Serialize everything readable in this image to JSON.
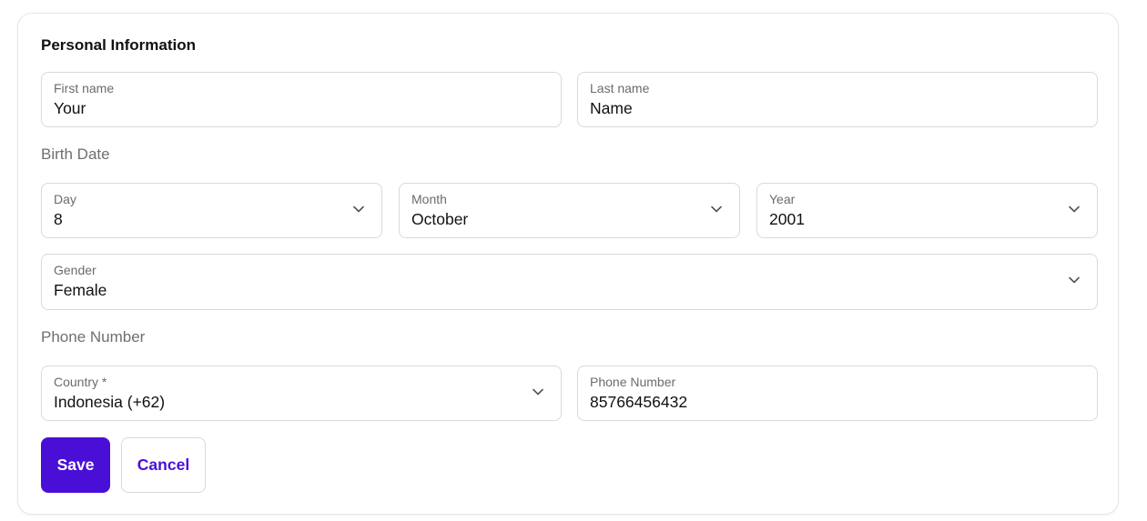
{
  "form": {
    "title": "Personal Information",
    "first_name": {
      "label": "First name",
      "value": "Your"
    },
    "last_name": {
      "label": "Last name",
      "value": "Name"
    },
    "birth_date_label": "Birth Date",
    "day": {
      "label": "Day",
      "value": "8"
    },
    "month": {
      "label": "Month",
      "value": "October"
    },
    "year": {
      "label": "Year",
      "value": "2001"
    },
    "gender": {
      "label": "Gender",
      "value": "Female"
    },
    "phone_section_label": "Phone Number",
    "country": {
      "label": "Country *",
      "value": "Indonesia (+62)"
    },
    "phone": {
      "label": "Phone Number",
      "value": "85766456432"
    }
  },
  "actions": {
    "save_label": "Save",
    "cancel_label": "Cancel"
  },
  "colors": {
    "accent": "#4a0fd6",
    "border": "#d9d9d9",
    "muted_text": "#6f6f6f"
  },
  "icons": {
    "dropdown": "chevron-down-icon"
  }
}
